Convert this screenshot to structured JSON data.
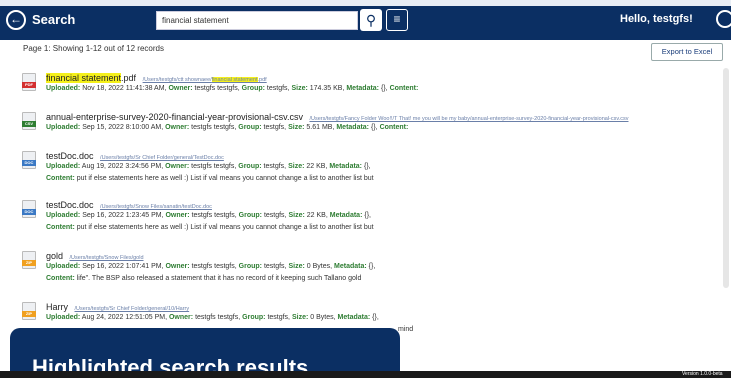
{
  "header": {
    "title": "Search",
    "search_value": "financial statement",
    "greeting": "Hello, testgfs!"
  },
  "toolbar": {
    "page_info": "Page 1: Showing 1-12 out of 12 records",
    "export_label": "Export to Excel"
  },
  "labels": {
    "uploaded": "Uploaded:",
    "owner": "Owner:",
    "group": "Group:",
    "size": "Size:",
    "metadata": "Metadata:",
    "content": "Content:"
  },
  "results": [
    {
      "name_highlight": "financial statement",
      "name_rest": ".pdf",
      "path_prefix": "/Users/testgfs/ctt shownaee/",
      "path_highlight": "financial statement",
      "path_suffix": ".pdf",
      "icon_type": "PDF",
      "uploaded": "Nov 18, 2022 11:41:38 AM,",
      "owner": "testgfs testgfs,",
      "group": "testgfs,",
      "size": "174.35 KB,",
      "metadata": "{},",
      "content": ""
    },
    {
      "name": "annual-enterprise-survey-2020-financial-year-provisional-csv.csv",
      "path": "/Users/testgfs/Fancy Folder Woo!!/T That! me you will be my baby/annual-enterprise-survey-2020-financial-year-provisional-csv.csv",
      "icon_type": "CSV",
      "uploaded": "Sep 15, 2022 8:10:00 AM,",
      "owner": "testgfs testgfs,",
      "group": "testgfs,",
      "size": "5.61 MB,",
      "metadata": "{},",
      "content": ""
    },
    {
      "name": "testDoc.doc",
      "path": "/Users/testgfs/Sr Chief Folder/general/TestDoc.doc",
      "icon_type": "DOC",
      "uploaded": "Aug 19, 2022 3:24:56 PM,",
      "owner": "testgfs testgfs,",
      "group": "testgfs,",
      "size": "22 KB,",
      "metadata": "{},",
      "content": "put if else statements here as well :) List if val means you cannot change a list to another list but"
    },
    {
      "name": "testDoc.doc",
      "path": "/Users/testgfs/Snow Files/sanatin/testDoc.doc",
      "icon_type": "DOC",
      "uploaded": "Sep 16, 2022 1:23:45 PM,",
      "owner": "testgfs testgfs,",
      "group": "testgfs,",
      "size": "22 KB,",
      "metadata": "{},",
      "content": "put if else statements here as well :) List if val means you cannot change a list to another list but"
    },
    {
      "name": "gold",
      "path": "/Users/testgfs/Snow Files/gold",
      "icon_type": "ZIP",
      "uploaded": "Sep 16, 2022 1:07:41 PM,",
      "owner": "testgfs testgfs,",
      "group": "testgfs,",
      "size": "0 Bytes,",
      "metadata": "{},",
      "content": "life\". The BSP also released a statement that it has no record of it keeping such Tallano gold"
    },
    {
      "name": "Harry",
      "path": "/Users/testgfs/Sr Chief Folder/general/10/Harry",
      "icon_type": "ZIP",
      "uploaded": "Aug 24, 2022 12:51:05 PM,",
      "owner": "testgfs testgfs,",
      "group": "testgfs,",
      "size": "0 Bytes,",
      "metadata": "{},",
      "content_tail": "mind"
    }
  ],
  "caption": "Highlighted search results",
  "version": "Version 1.0.0-beta"
}
